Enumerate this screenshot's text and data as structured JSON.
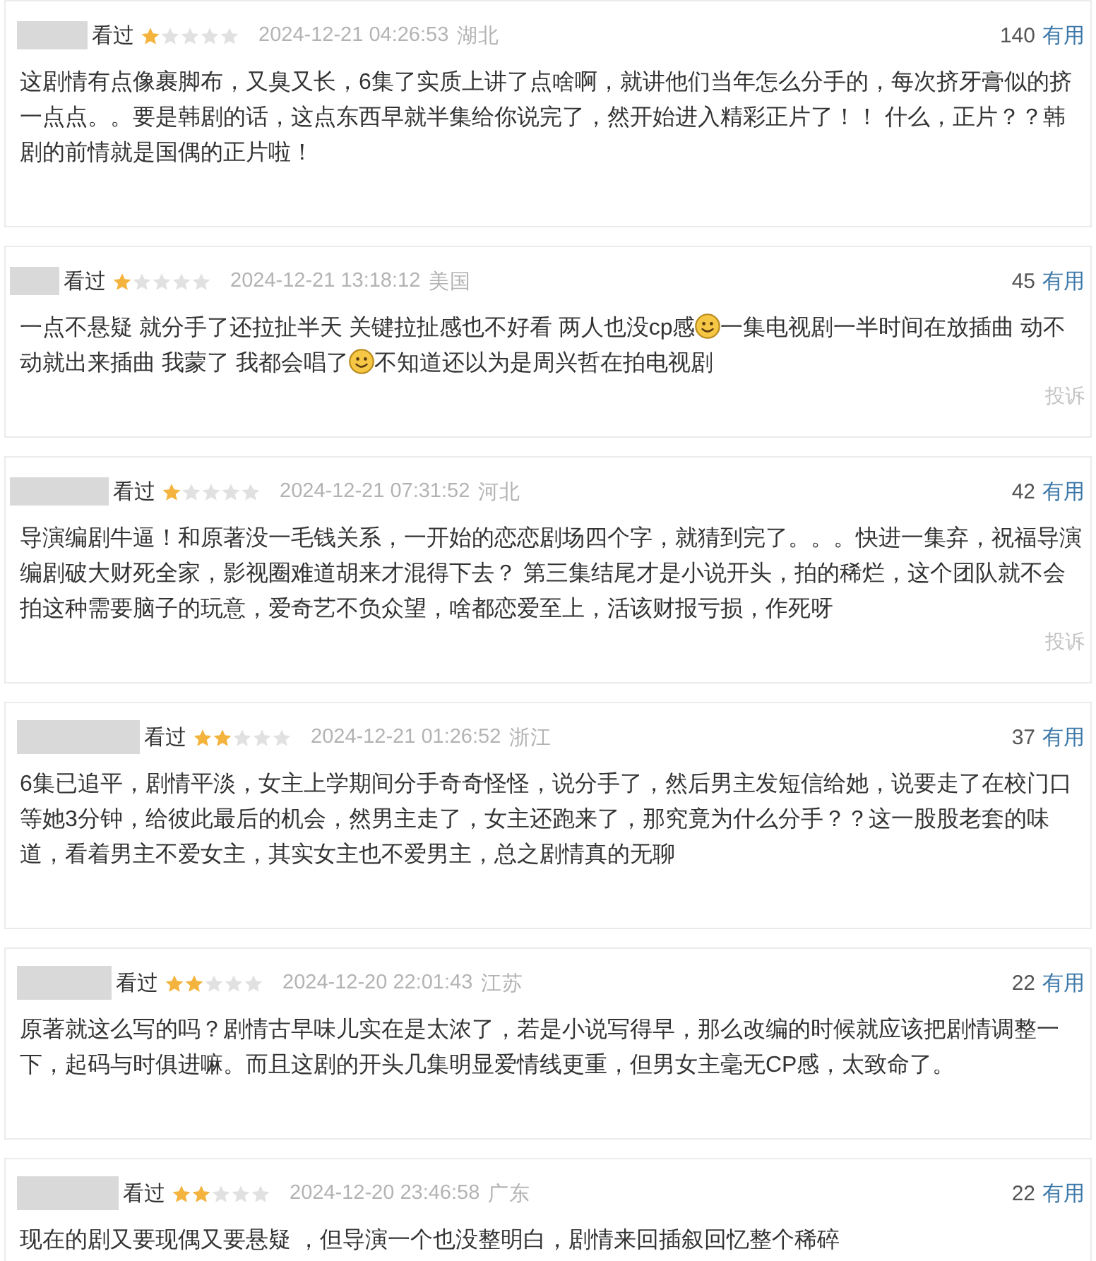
{
  "reviews": [
    {
      "status": "看过",
      "stars": 1,
      "time": "2024-12-21 04:26:53",
      "location": "湖北",
      "useful_count": "140",
      "useful_label": "有用",
      "content": [
        {
          "kind": "text",
          "text": "这剧情有点像裹脚布，又臭又长，6集了实质上讲了点啥啊，就讲他们当年怎么分手的，每次挤牙膏似的挤一点点。。要是韩剧的话，这点东西早就半集给你说完了，然开始进入精彩正片了！！ 什么，正片？？韩剧的前情就是国偶的正片啦！"
        }
      ]
    },
    {
      "status": "看过",
      "stars": 1,
      "time": "2024-12-21 13:18:12",
      "location": "美国",
      "useful_count": "45",
      "useful_label": "有用",
      "content": [
        {
          "kind": "text",
          "text": "一点不悬疑 就分手了还拉扯半天 关键拉扯感也不好看 两人也没cp感"
        },
        {
          "kind": "smiley"
        },
        {
          "kind": "text",
          "text": "一集电视剧一半时间在放插曲 动不动就出来插曲 我蒙了 我都会唱了"
        },
        {
          "kind": "smiley"
        },
        {
          "kind": "text",
          "text": "不知道还以为是周兴哲在拍电视剧"
        }
      ],
      "report_label": "投诉"
    },
    {
      "status": "看过",
      "stars": 1,
      "time": "2024-12-21 07:31:52",
      "location": "河北",
      "useful_count": "42",
      "useful_label": "有用",
      "content": [
        {
          "kind": "text",
          "text": "导演编剧牛逼！和原著没一毛钱关系，一开始的恋恋剧场四个字，就猜到完了。。。快进一集弃，祝福导演编剧破大财死全家，影视圈难道胡来才混得下去？ 第三集结尾才是小说开头，拍的稀烂，这个团队就不会拍这种需要脑子的玩意，爱奇艺不负众望，啥都恋爱至上，活该财报亏损，作死呀"
        }
      ],
      "report_label": "投诉"
    },
    {
      "status": "看过",
      "stars": 2,
      "time": "2024-12-21 01:26:52",
      "location": "浙江",
      "useful_count": "37",
      "useful_label": "有用",
      "content": [
        {
          "kind": "text",
          "text": "6集已追平，剧情平淡，女主上学期间分手奇奇怪怪，说分手了，然后男主发短信给她，说要走了在校门口等她3分钟，给彼此最后的机会，然男主走了，女主还跑来了，那究竟为什么分手？？这一股股老套的味道，看着男主不爱女主，其实女主也不爱男主，总之剧情真的无聊"
        }
      ]
    },
    {
      "status": "看过",
      "stars": 2,
      "time": "2024-12-20 22:01:43",
      "location": "江苏",
      "useful_count": "22",
      "useful_label": "有用",
      "content": [
        {
          "kind": "text",
          "text": "原著就这么写的吗？剧情古早味儿实在是太浓了，若是小说写得早，那么改编的时候就应该把剧情调整一下，起码与时俱进嘛。而且这剧的开头几集明显爱情线更重，但男女主毫无CP感，太致命了。"
        }
      ]
    },
    {
      "status": "看过",
      "stars": 2,
      "time": "2024-12-20 23:46:58",
      "location": "广东",
      "useful_count": "22",
      "useful_label": "有用",
      "content": [
        {
          "kind": "text",
          "text": "现在的剧又要现偶又要悬疑 ，但导演一个也没整明白，剧情来回插叙回忆整个稀碎"
        }
      ]
    }
  ]
}
